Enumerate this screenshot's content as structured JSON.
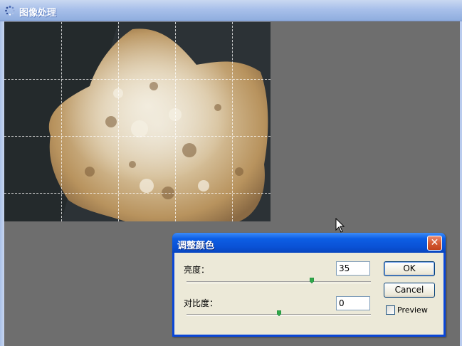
{
  "window": {
    "title": "图像处理"
  },
  "dialog": {
    "title": "调整颜色",
    "close_glyph": "✕",
    "brightness": {
      "label": "亮度：",
      "value": "35",
      "slider_fraction": 0.68
    },
    "contrast": {
      "label": "对比度：",
      "value": "0",
      "slider_fraction": 0.5
    },
    "ok_label": "OK",
    "cancel_label": "Cancel",
    "preview_label": "Preview",
    "preview_checked": false
  },
  "colors": {
    "titlebar_blue": "#0a52d6",
    "dialog_face": "#ece9d8",
    "workspace": "#6e6e6e",
    "close_red": "#d45a33"
  },
  "icons": {
    "app": "spinner-icon",
    "close": "close-icon",
    "cursor": "arrow-cursor-icon"
  }
}
